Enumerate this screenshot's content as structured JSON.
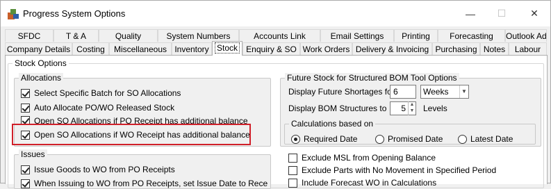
{
  "window": {
    "title": "Progress System Options"
  },
  "tabs_row1": [
    "SFDC",
    "T & A",
    "Quality",
    "System Numbers",
    "Accounts Link",
    "Email Settings",
    "Printing",
    "Forecasting",
    "Outlook Add-In"
  ],
  "tabs_row2": [
    "Company Details",
    "Costing",
    "Miscellaneous",
    "Inventory",
    "Stock",
    "Enquiry & SO",
    "Work Orders",
    "Delivery & Invoicing",
    "Purchasing",
    "Notes",
    "Labour"
  ],
  "active_tab": "Stock",
  "stock_options": {
    "title": "Stock Options",
    "allocations": {
      "title": "Allocations",
      "items": [
        {
          "label": "Select Specific Batch for SO Allocations",
          "checked": true
        },
        {
          "label": "Auto Allocate PO/WO Released Stock",
          "checked": true
        },
        {
          "label": "Open SO Allocations if PO Receipt has additional balance",
          "checked": true
        },
        {
          "label": "Open SO Allocations if WO Receipt has additional balance",
          "checked": true
        }
      ]
    },
    "issues": {
      "title": "Issues",
      "items": [
        {
          "label": "Issue Goods to WO from PO Receipts",
          "checked": true
        },
        {
          "label": "When Issuing to WO from PO Receipts, set Issue Date to Receipt Date",
          "checked": true
        }
      ]
    },
    "future_stock": {
      "title": "Future Stock for Structured BOM Tool Options",
      "shortages_label": "Display Future Shortages for",
      "shortages_value": "6",
      "shortages_unit": "Weeks",
      "bom_label": "Display BOM Structures to",
      "bom_value": "5",
      "bom_unit": "Levels",
      "calc_title": "Calculations based on",
      "calc_options": [
        "Required Date",
        "Promised Date",
        "Latest Date"
      ],
      "calc_selected": "Required Date"
    },
    "extra_checks": [
      {
        "label": "Exclude MSL from Opening Balance",
        "checked": false
      },
      {
        "label": "Exclude Parts with No Movement in Specified Period",
        "checked": false
      },
      {
        "label": "Include Forecast WO in Calculations",
        "checked": false
      }
    ]
  },
  "colors": {
    "highlight": "#d0202a"
  }
}
